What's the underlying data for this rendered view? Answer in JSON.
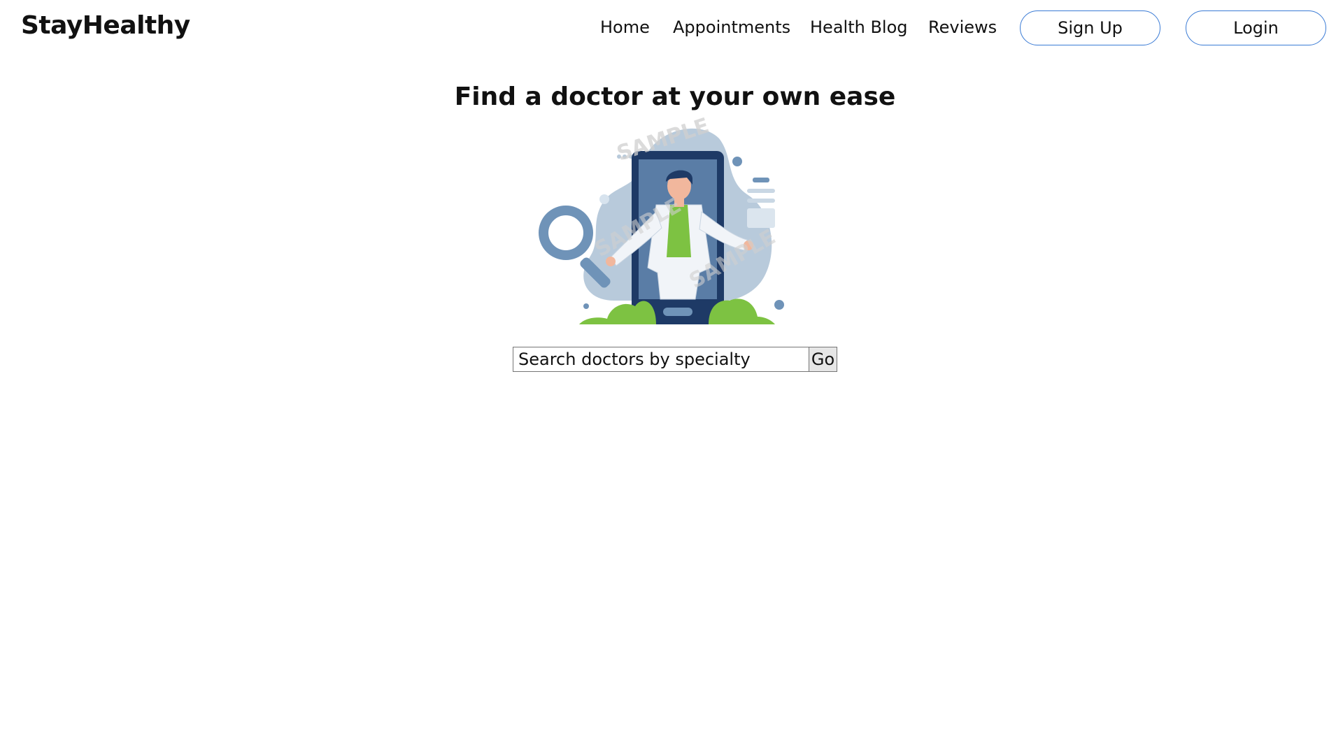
{
  "app": {
    "brand": "StayHealthy"
  },
  "nav": {
    "links": [
      {
        "label": "Home"
      },
      {
        "label": "Appointments"
      },
      {
        "label": "Health Blog"
      },
      {
        "label": "Reviews"
      }
    ],
    "signup_label": "Sign Up",
    "login_label": "Login"
  },
  "hero": {
    "title": "Find a doctor at your own ease",
    "illustration_icon": "doctor-phone-illustration",
    "watermark_text": "SAMPLE"
  },
  "search": {
    "placeholder": "Search doctors by specialty",
    "value": "",
    "button_label": "Go"
  },
  "colors": {
    "accent_border": "#3a7bd5",
    "illustration_navy": "#1e3a66",
    "illustration_blue": "#6f93b8",
    "illustration_green": "#7dc242",
    "illustration_blob": "#b8cadb"
  }
}
